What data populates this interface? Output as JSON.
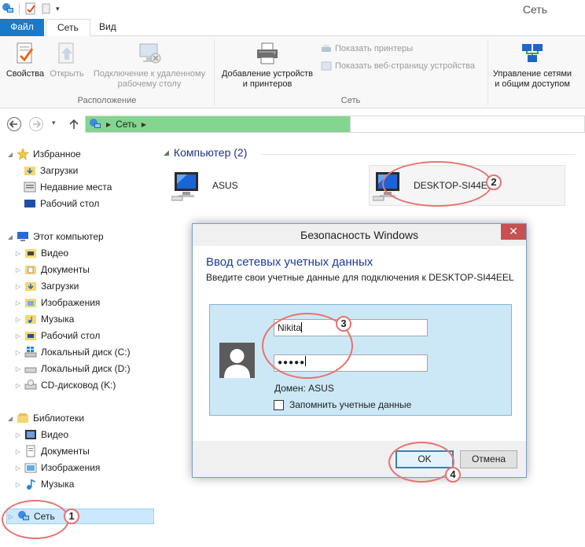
{
  "window": {
    "title": "Сеть"
  },
  "ribbon_tabs": {
    "file": "Файл",
    "network": "Сеть",
    "view": "Вид"
  },
  "ribbon": {
    "properties": "Свойства",
    "open": "Открыть",
    "remote_line1": "Подключение к удаленному",
    "remote_line2": "рабочему столу",
    "location_group": "Расположение",
    "add_devices_line1": "Добавление устройств",
    "add_devices_line2": "и принтеров",
    "show_printers": "Показать принтеры",
    "show_device_page": "Показать веб-страницу устройства",
    "network_group": "Сеть",
    "network_center_line1": "Управление сетями",
    "network_center_line2": "и общим доступом"
  },
  "address": {
    "path": "Сеть"
  },
  "nav": {
    "favorites": "Избранное",
    "downloads": "Загрузки",
    "recent": "Недавние места",
    "desktop": "Рабочий стол",
    "this_pc": "Этот компьютер",
    "videos": "Видео",
    "documents": "Документы",
    "downloads2": "Загрузки",
    "pictures": "Изображения",
    "music": "Музыка",
    "desktop2": "Рабочий стол",
    "disk_c": "Локальный диск (C:)",
    "disk_d": "Локальный диск (D:)",
    "cd_drive": "CD-дисковод (K:)",
    "libraries": "Библиотеки",
    "lib_videos": "Видео",
    "lib_documents": "Документы",
    "lib_pictures": "Изображения",
    "lib_music": "Музыка",
    "network": "Сеть"
  },
  "content": {
    "group_title": "Компьютер (2)",
    "computers": [
      "ASUS",
      "DESKTOP-SI44EEL"
    ]
  },
  "dialog": {
    "title": "Безопасность Windows",
    "close": "✕",
    "heading": "Ввод сетевых учетных данных",
    "subheading": "Введите свои учетные данные для подключения к DESKTOP-SI44EEL",
    "username": "Nikita",
    "password_mask": "●●●●●",
    "domain": "Домен: ASUS",
    "remember": "Запомнить учетные данные",
    "ok": "OK",
    "cancel": "Отмена"
  },
  "annotations": [
    "1",
    "2",
    "3",
    "4"
  ],
  "colors": {
    "accent": "#1979ca",
    "address_progress": "#84d590",
    "annotation": "#e8736f",
    "dialog_panel": "#cce8f6"
  }
}
